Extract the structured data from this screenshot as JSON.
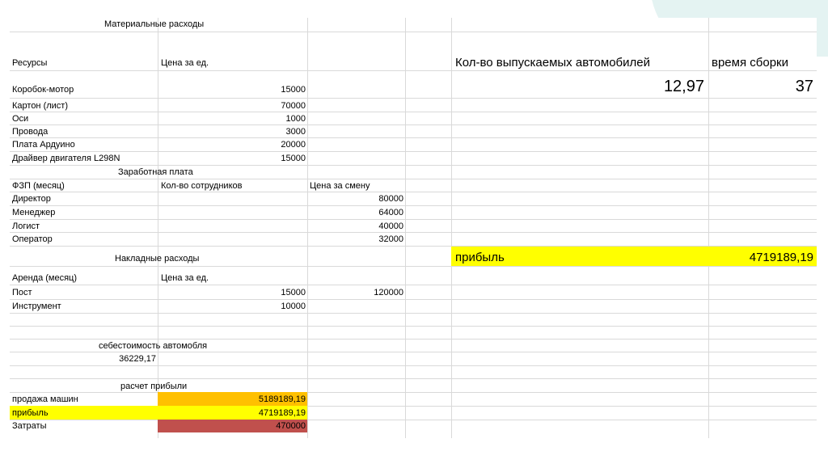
{
  "colors": {
    "yellow": "#ffff00",
    "orange": "#ffc000",
    "red": "#c0504d",
    "grid": "#d9d9d9"
  },
  "sections": {
    "materials_title": "Материальные расходы",
    "salary_title": "Заработная плата",
    "overhead_title": "Накладные расходы",
    "cost_title": "себестоимость автомобля",
    "profit_calc_title": "расчет прибыли"
  },
  "materials": {
    "col_resources": "Ресурсы",
    "col_price": "Цена за ед.",
    "rows": [
      {
        "name": "Коробок-мотор",
        "price": "15000"
      },
      {
        "name": "Картон (лист)",
        "price": "70000"
      },
      {
        "name": "Оси",
        "price": "1000"
      },
      {
        "name": "Провода",
        "price": "3000"
      },
      {
        "name": "Плата Ардуино",
        "price": "20000"
      },
      {
        "name": "Драйвер двигателя L298N",
        "price": "15000"
      }
    ]
  },
  "salary": {
    "col_fzp": "ФЗП (месяц)",
    "col_count": "Кол-во сотрудников",
    "col_shift": "Цена за смену",
    "rows": [
      {
        "name": "Директор",
        "value": "80000"
      },
      {
        "name": "Менеджер",
        "value": "64000"
      },
      {
        "name": "Логист",
        "value": "40000"
      },
      {
        "name": "Оператор",
        "value": "32000"
      }
    ]
  },
  "overhead": {
    "col_rent": "Аренда (месяц)",
    "col_price": "Цена за ед.",
    "rows": [
      {
        "name": "Пост",
        "price": "15000",
        "extra": "120000"
      },
      {
        "name": "Инструмент",
        "price": "10000",
        "extra": ""
      }
    ]
  },
  "cost": {
    "value": "36229,17"
  },
  "profit_calc": {
    "rows": [
      {
        "name": "продажа машин",
        "value": "5189189,19"
      },
      {
        "name": "прибыль",
        "value": "4719189,19"
      },
      {
        "name": "Затраты",
        "value": "470000"
      }
    ]
  },
  "right": {
    "cars_label": "Кол-во выпускаемых автомобилей",
    "assembly_label": "время сборки",
    "cars_value": "12,97",
    "assembly_value": "37",
    "profit_label": "прибыль",
    "profit_value": "4719189,19"
  }
}
